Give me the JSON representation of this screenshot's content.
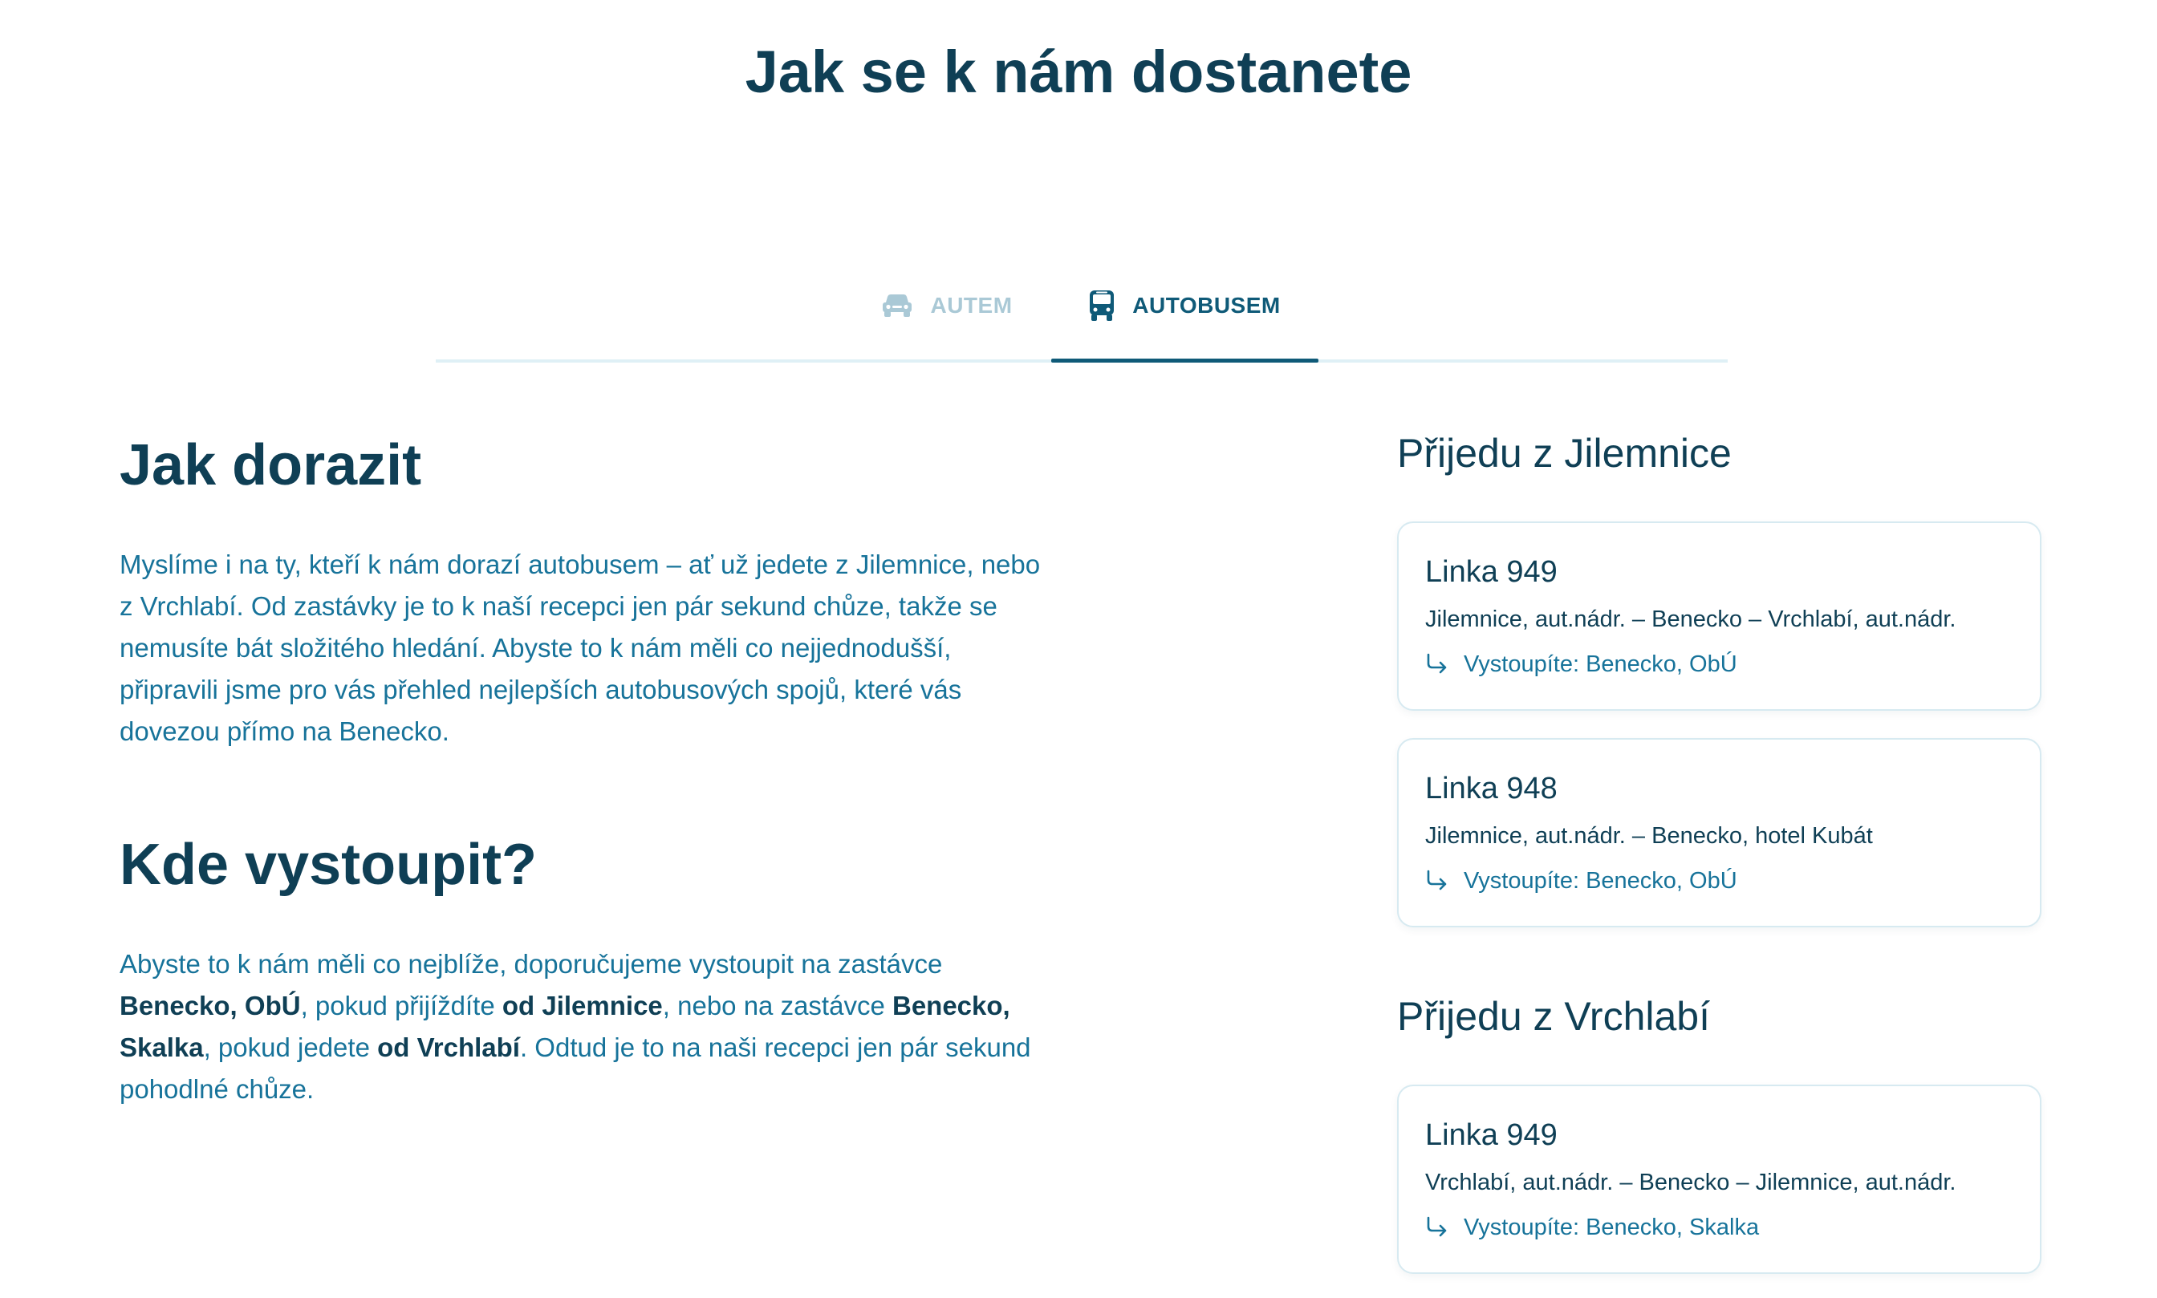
{
  "page": {
    "title": "Jak se k nám dostanete"
  },
  "tabs": [
    {
      "label": "AUTEM",
      "icon": "car-icon",
      "active": false
    },
    {
      "label": "AUTOBUSEM",
      "icon": "bus-icon",
      "active": true
    }
  ],
  "colors": {
    "heading": "#0f3f55",
    "text_accent": "#17739a",
    "tab_inactive": "#aac9d6",
    "tab_active": "#0f5a78",
    "divider": "#dff0f6",
    "card_border": "#d7eaf1"
  },
  "main": {
    "arrive": {
      "heading": "Jak dorazit",
      "text": "Myslíme i na ty, kteří k nám dorazí autobusem – ať už jedete z Jilemnice, nebo z Vrchlabí. Od zastávky je to k naší recepci jen pár sekund chůze, takže se nemusíte bát složitého hledání. Abyste to k nám měli co nejjednodušší, připravili jsme pro vás přehled nejlepších autobusových spojů, které vás dovezou přímo na Benecko."
    },
    "where": {
      "heading": "Kde vystoupit?",
      "p1": "Abyste to k nám měli co nejblíže, doporučujeme vystoupit na zastávce ",
      "b1": "Benecko, ObÚ",
      "p2": ", pokud přijíždíte ",
      "b2": "od Jilemnice",
      "p3": ", nebo na zastávce ",
      "b3": "Benecko, Skalka",
      "p4": ", pokud jedete ",
      "b4": "od Vrchlabí",
      "p5": ". Odtud je to na naši recepci jen pár sekund pohodlné chůze."
    }
  },
  "sidebar": {
    "from_jilemnice": {
      "heading": "Přijedu z Jilemnice",
      "lines": [
        {
          "title": "Linka 949",
          "route": "Jilemnice, aut.nádr. – Benecko – Vrchlabí, aut.nádr.",
          "stop": "Vystoupíte: Benecko, ObÚ"
        },
        {
          "title": "Linka 948",
          "route": "Jilemnice, aut.nádr. – Benecko, hotel Kubát",
          "stop": "Vystoupíte: Benecko, ObÚ"
        }
      ]
    },
    "from_vrchlabi": {
      "heading": "Přijedu z Vrchlabí",
      "lines": [
        {
          "title": "Linka 949",
          "route": "Vrchlabí, aut.nádr. – Benecko – Jilemnice, aut.nádr.",
          "stop": "Vystoupíte: Benecko, Skalka"
        }
      ]
    }
  }
}
